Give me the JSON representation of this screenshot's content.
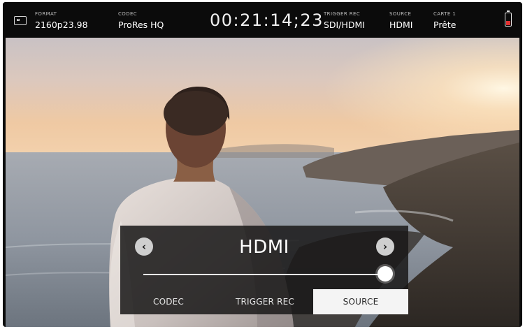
{
  "status_bar": {
    "format": {
      "label": "FORMAT",
      "value": "2160p23.98"
    },
    "codec": {
      "label": "CODEC",
      "value": "ProRes HQ"
    },
    "timecode": "00:21:14;23",
    "trigger_rec": {
      "label": "TRIGGER REC",
      "value": "SDI/HDMI"
    },
    "source": {
      "label": "SOURCE",
      "value": "HDMI"
    },
    "card": {
      "label": "CARTE 1",
      "value": "Prête"
    },
    "battery_level": 0.35
  },
  "overlay": {
    "title": "HDMI",
    "prev_icon": "chevron-left-icon",
    "next_icon": "chevron-right-icon",
    "slider_value": 1.0,
    "tabs": [
      {
        "label": "CODEC",
        "active": false
      },
      {
        "label": "TRIGGER REC",
        "active": false
      },
      {
        "label": "SOURCE",
        "active": true
      }
    ]
  },
  "colors": {
    "status_bar_bg": "#0b0b0b",
    "overlay_bg": "#1a1819",
    "active_tab_bg": "#f4f4f4",
    "battery_red": "#e03131"
  }
}
